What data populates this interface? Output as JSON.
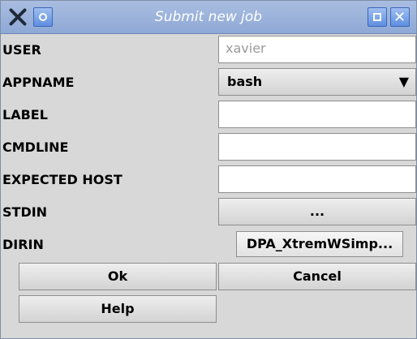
{
  "window": {
    "title": "Submit new job",
    "icons": {
      "close": "close-x-icon",
      "menu": "window-menu-icon",
      "maximize": "maximize-icon",
      "close_right": "close-icon"
    }
  },
  "form": {
    "rows": [
      {
        "label": "USER",
        "value": "xavier"
      },
      {
        "label": "APPNAME",
        "selected": "bash"
      },
      {
        "label": "LABEL",
        "value": ""
      },
      {
        "label": "CMDLINE",
        "value": ""
      },
      {
        "label": "EXPECTED HOST",
        "value": ""
      },
      {
        "label": "STDIN",
        "button": "..."
      },
      {
        "label": "DIRIN",
        "button": "DPA_XtremWSimp..."
      }
    ]
  },
  "actions": {
    "ok": "Ok",
    "cancel": "Cancel",
    "help": "Help"
  }
}
